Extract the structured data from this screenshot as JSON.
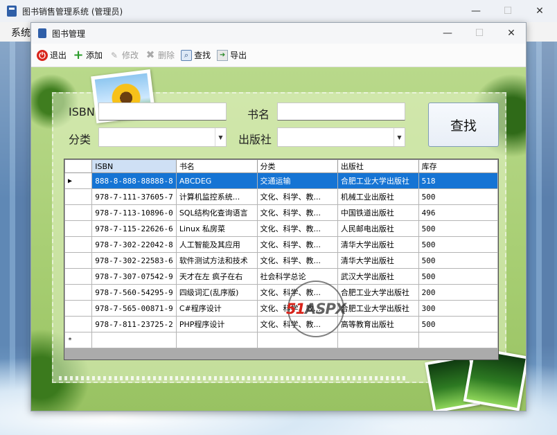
{
  "outer_window": {
    "title": "图书销售管理系统 (管理员)",
    "menu_item": "系统",
    "controls": {
      "minimize": "—",
      "maximize": "☐",
      "close": "✕"
    }
  },
  "child_window": {
    "title": "图书管理",
    "controls": {
      "minimize": "—",
      "maximize": "☐",
      "close": "✕"
    }
  },
  "toolbar": {
    "exit_label": "退出",
    "add_label": "添加",
    "edit_label": "修改",
    "delete_label": "删除",
    "find_label": "查找",
    "export_label": "导出"
  },
  "search_form": {
    "isbn_label": "ISBN",
    "isbn_value": "",
    "title_label": "书名",
    "title_value": "",
    "category_label": "分类",
    "category_value": "",
    "publisher_label": "出版社",
    "publisher_value": "",
    "search_button": "查找"
  },
  "grid": {
    "columns": [
      "ISBN",
      "书名",
      "分类",
      "出版社",
      "库存"
    ],
    "current_row_marker": "▶",
    "new_row_marker": "*",
    "rows": [
      [
        "888-8-888-88888-8",
        "ABCDEG",
        "交通运输",
        "合肥工业大学出版社",
        "518"
      ],
      [
        "978-7-111-37605-7",
        "计算机监控系统...",
        "文化、科学、教...",
        "机械工业出版社",
        "500"
      ],
      [
        "978-7-113-10896-0",
        "SQL结构化查询语言",
        "文化、科学、教...",
        "中国铁道出版社",
        "496"
      ],
      [
        "978-7-115-22626-6",
        "Linux 私房菜",
        "文化、科学、教...",
        "人民邮电出版社",
        "500"
      ],
      [
        "978-7-302-22042-8",
        "人工智能及其应用",
        "文化、科学、教...",
        "清华大学出版社",
        "500"
      ],
      [
        "978-7-302-22583-6",
        "软件测试方法和技术",
        "文化、科学、教...",
        "清华大学出版社",
        "500"
      ],
      [
        "978-7-307-07542-9",
        "天才在左 疯子在右",
        "社会科学总论",
        "武汉大学出版社",
        "500"
      ],
      [
        "978-7-560-54295-9",
        "四级词汇(乱序版)",
        "文化、科学、教...",
        "合肥工业大学出版社",
        "200"
      ],
      [
        "978-7-565-00871-9",
        "C#程序设计",
        "文化、科学、教...",
        "合肥工业大学出版社",
        "300"
      ],
      [
        "978-7-811-23725-2",
        "PHP程序设计",
        "文化、科学、教...",
        "高等教育出版社",
        "500"
      ]
    ]
  },
  "watermark": {
    "part1": "51",
    "part2": "ASPX"
  }
}
